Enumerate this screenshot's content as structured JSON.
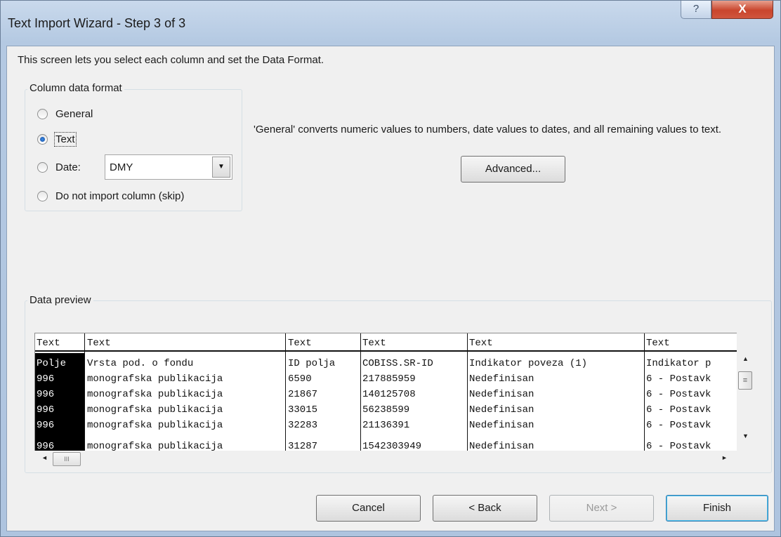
{
  "window": {
    "title": "Text Import Wizard - Step 3 of 3",
    "help_glyph": "?",
    "close_glyph": "X"
  },
  "description": "This screen lets you select each column and set the Data Format.",
  "column_format": {
    "label": "Column data format",
    "options": [
      {
        "label": "General",
        "selected": false
      },
      {
        "label": "Text",
        "selected": true
      },
      {
        "label": "Date:",
        "selected": false
      },
      {
        "label": "Do not import column (skip)",
        "selected": false
      }
    ],
    "date_value": "DMY"
  },
  "info_text": "'General' converts numeric values to numbers, date values to dates, and all remaining values to text.",
  "advanced_label": "Advanced...",
  "preview": {
    "label": "Data preview",
    "headers": [
      "Text",
      "Text",
      "Text",
      "Text",
      "Text",
      "Text"
    ],
    "rows": [
      [
        "Polje",
        "Vrsta pod. o fondu",
        "ID polja",
        "COBISS.SR-ID",
        "Indikator poveza (1)",
        "Indikator p"
      ],
      [
        "996",
        "monografska publikacija",
        "6590",
        "217885959",
        "Nedefinisan",
        "6 - Postavk"
      ],
      [
        "996",
        "monografska publikacija",
        "21867",
        "140125708",
        "Nedefinisan",
        "6 - Postavk"
      ],
      [
        "996",
        "monografska publikacija",
        "33015",
        "56238599",
        "Nedefinisan",
        "6 - Postavk"
      ],
      [
        "996",
        "monografska publikacija",
        "32283",
        "21136391",
        "Nedefinisan",
        "6 - Postavk"
      ],
      [
        "996",
        "monografska publikacija",
        "31287",
        "1542303949",
        "Nedefinisan",
        "6 - Postavk"
      ]
    ]
  },
  "scroll": {
    "up": "▲",
    "down": "▼",
    "left": "◄",
    "right": "►",
    "grip": "≡",
    "hgrip": "III"
  },
  "buttons": {
    "cancel": "Cancel",
    "back": "< Back",
    "next": "Next >",
    "finish": "Finish"
  },
  "icons": {
    "combo_arrow": "▼"
  }
}
